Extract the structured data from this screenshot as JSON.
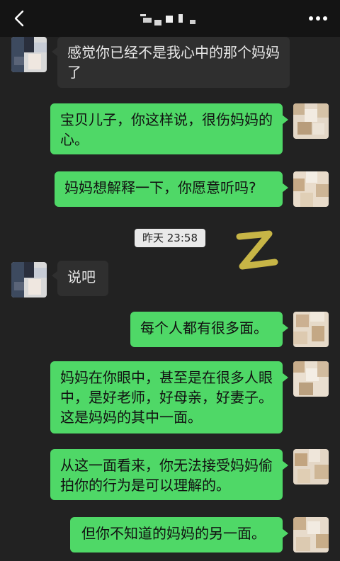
{
  "header": {
    "contact_name": "",
    "icons": {
      "back": "chevron-left-icon",
      "more": "more-horizontal-icon"
    }
  },
  "colors": {
    "sent_bubble": "#4fd867",
    "received_bubble": "#2f2f2f",
    "chat_background": "#222222",
    "watermark": "#d9c54a"
  },
  "messages": [
    {
      "side": "received",
      "text": "感觉你已经不是我心中的那个妈妈了"
    },
    {
      "side": "sent",
      "text": "宝贝儿子，你这样说，很伤妈妈的心。"
    },
    {
      "side": "sent",
      "text": "妈妈想解释一下，你愿意听吗?"
    },
    {
      "type": "timestamp",
      "text": "昨天 23:58"
    },
    {
      "side": "received",
      "text": "说吧"
    },
    {
      "side": "sent",
      "text": "每个人都有很多面。"
    },
    {
      "side": "sent",
      "text": "妈妈在你眼中，甚至是在很多人眼中，是好老师，好母亲，好妻子。这是妈妈的其中一面。"
    },
    {
      "side": "sent",
      "text": "从这一面看来，你无法接受妈妈偷拍你的行为是可以理解的。"
    },
    {
      "side": "sent",
      "text": "但你不知道的妈妈的另一面。"
    }
  ]
}
